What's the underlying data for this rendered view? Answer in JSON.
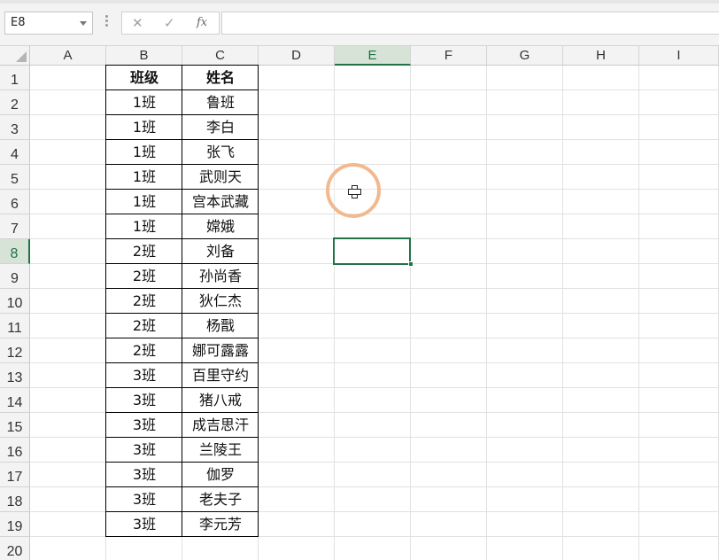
{
  "formula_bar": {
    "name_box": "E8",
    "cancel_icon": "close-icon",
    "enter_icon": "check-icon",
    "fx_label": "fx",
    "formula_value": ""
  },
  "columns": [
    "A",
    "B",
    "C",
    "D",
    "E",
    "F",
    "G",
    "H",
    "I"
  ],
  "rows": [
    "1",
    "2",
    "3",
    "4",
    "5",
    "6",
    "7",
    "8",
    "9",
    "10",
    "11",
    "12",
    "13",
    "14",
    "15",
    "16",
    "17",
    "18",
    "19",
    "20"
  ],
  "selected": {
    "column": "E",
    "row": "8"
  },
  "table": {
    "headers": [
      "班级",
      "姓名"
    ],
    "rows": [
      [
        "1班",
        "鲁班"
      ],
      [
        "1班",
        "李白"
      ],
      [
        "1班",
        "张飞"
      ],
      [
        "1班",
        "武则天"
      ],
      [
        "1班",
        "宫本武藏"
      ],
      [
        "1班",
        "嫦娥"
      ],
      [
        "2班",
        "刘备"
      ],
      [
        "2班",
        "孙尚香"
      ],
      [
        "2班",
        "狄仁杰"
      ],
      [
        "2班",
        "杨戬"
      ],
      [
        "2班",
        "娜可露露"
      ],
      [
        "3班",
        "百里守约"
      ],
      [
        "3班",
        "猪八戒"
      ],
      [
        "3班",
        "成吉思汗"
      ],
      [
        "3班",
        "兰陵王"
      ],
      [
        "3班",
        "伽罗"
      ],
      [
        "3班",
        "老夫子"
      ],
      [
        "3班",
        "李元芳"
      ]
    ]
  },
  "colors": {
    "accent": "#217346",
    "cursor_ring": "#f2b98e"
  }
}
